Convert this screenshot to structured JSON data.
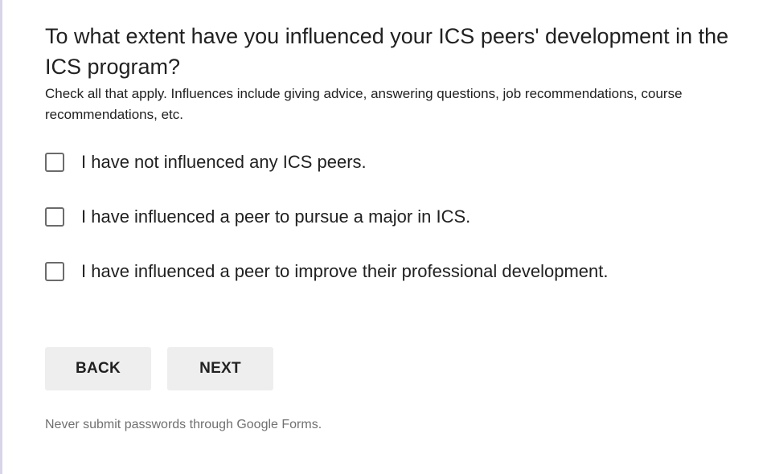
{
  "question": {
    "title": "To what extent have you influenced your ICS peers' development in the ICS program?",
    "help_text": "Check all that apply. Influences include giving advice, answering questions, job recommendations, course recommendations, etc.",
    "options": [
      {
        "label": "I have not influenced any ICS peers.",
        "checked": false
      },
      {
        "label": "I have influenced a peer to pursue a major in ICS.",
        "checked": false
      },
      {
        "label": "I have influenced a peer to improve their professional development.",
        "checked": false
      }
    ]
  },
  "navigation": {
    "back_label": "BACK",
    "next_label": "NEXT"
  },
  "footer": {
    "note": "Never submit passwords through Google Forms."
  },
  "colors": {
    "button_bg": "#eeeeee",
    "text": "#212121",
    "muted_text": "#707070",
    "checkbox_border": "#6b6b6b",
    "left_rule": "#d9d5e8"
  }
}
